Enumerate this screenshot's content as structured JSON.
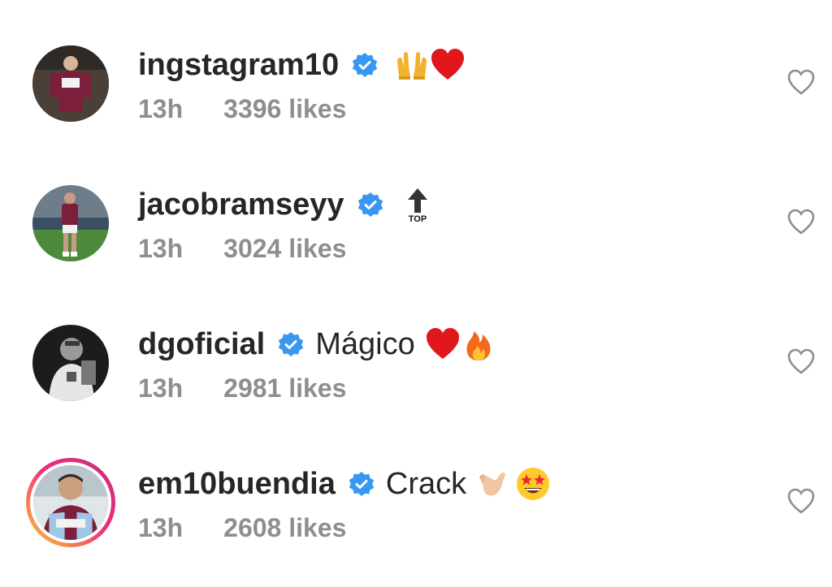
{
  "comments": [
    {
      "username": "ingstagram10",
      "text": "",
      "emojis": [
        "raised-hands-emoji",
        "red-heart-emoji"
      ],
      "time": "13h",
      "likes": "3396 likes",
      "avatar_colors": {
        "bg": "#5a4a3e",
        "shirt": "#7b1f3a"
      }
    },
    {
      "username": "jacobramseyy",
      "text": "",
      "emojis": [
        "top-arrow-emoji"
      ],
      "top_label": "TOP",
      "time": "13h",
      "likes": "3024 likes",
      "avatar_colors": {
        "bg": "#6d8a5a",
        "shirt": "#7b1f3a"
      }
    },
    {
      "username": "dgoficial",
      "text": "Mágico",
      "emojis": [
        "red-heart-emoji",
        "fire-emoji"
      ],
      "time": "13h",
      "likes": "2981 likes",
      "avatar_colors": {
        "bg": "#1a1a1a",
        "shirt": "#e6e6e6"
      }
    },
    {
      "username": "em10buendia",
      "text": "Crack",
      "emojis": [
        "call-me-hand-emoji",
        "star-struck-emoji"
      ],
      "time": "13h",
      "likes": "2608 likes",
      "avatar_colors": {
        "bg": "#dfe6ea",
        "shirt": "#7b1f3a"
      }
    }
  ],
  "colors": {
    "verified": "#3897f0",
    "meta": "#8e8e8e",
    "heart_outline": "#8e8e8e",
    "emoji_heart": "#e0171b"
  }
}
